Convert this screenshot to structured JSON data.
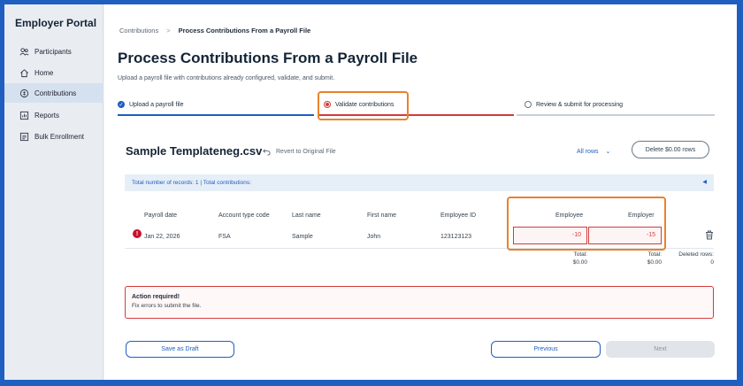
{
  "sidebar": {
    "brand": "Employer Portal",
    "items": [
      {
        "label": "Participants",
        "icon": "people-icon"
      },
      {
        "label": "Home",
        "icon": "home-icon"
      },
      {
        "label": "Contributions",
        "icon": "contributions-icon",
        "active": true
      },
      {
        "label": "Reports",
        "icon": "reports-icon"
      },
      {
        "label": "Bulk Enrollment",
        "icon": "bulk-enrollment-icon"
      }
    ]
  },
  "breadcrumb": {
    "parent": "Contributions",
    "separator": ">",
    "current": "Process Contributions From a Payroll File"
  },
  "page": {
    "title": "Process Contributions From a Payroll File",
    "subtitle": "Upload a payroll file with contributions already configured, validate, and submit."
  },
  "steps": [
    {
      "label": "Upload a payroll file",
      "state": "done"
    },
    {
      "label": "Validate contributions",
      "state": "current"
    },
    {
      "label": "Review & submit for processing",
      "state": "todo"
    }
  ],
  "file": {
    "name": "Sample Templateneg.csv",
    "revert_label": "Revert to Original File",
    "filter_label": "All rows",
    "delete_label": "Delete $0.00 rows"
  },
  "summary": {
    "text": "Total number of records: 1 | Total contributions:"
  },
  "table": {
    "headers": [
      "Payroll date",
      "Account type code",
      "Last name",
      "First name",
      "Employee ID",
      "Employee",
      "Employer"
    ],
    "rows": [
      {
        "payroll_date": "Jan 22, 2026",
        "account_type": "FSA",
        "last_name": "Sample",
        "first_name": "John",
        "employee_id": "123123123",
        "employee": "-10",
        "employer": "-15",
        "has_error": true
      }
    ],
    "totals": {
      "employee_label": "Total:",
      "employee_value": "$0.00",
      "employer_label": "Total:",
      "employer_value": "$0.00",
      "deleted_label": "Deleted rows:",
      "deleted_value": "0"
    }
  },
  "alert": {
    "title": "Action required!",
    "message": "Fix errors to submit the file."
  },
  "actions": {
    "draft": "Save as Draft",
    "previous": "Previous",
    "next": "Next"
  },
  "colors": {
    "accent": "#1f5fbf",
    "error": "#d43a3a",
    "highlight": "#e8822c"
  }
}
